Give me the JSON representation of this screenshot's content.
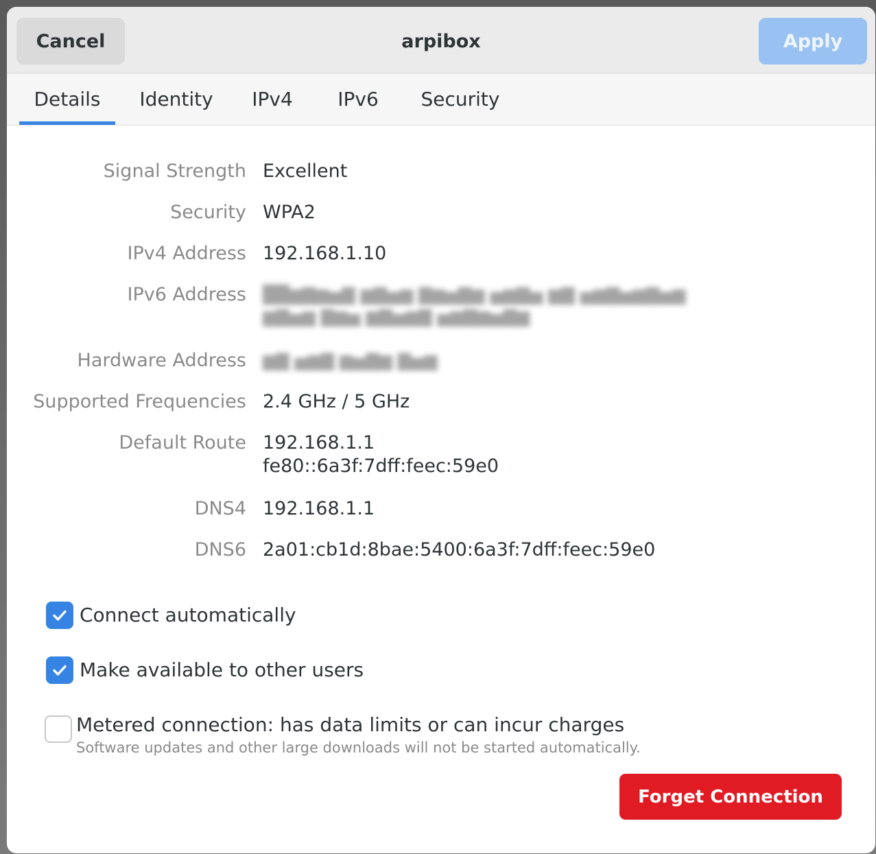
{
  "header": {
    "cancel_label": "Cancel",
    "title": "arpibox",
    "apply_label": "Apply"
  },
  "tabs": [
    {
      "label": "Details",
      "active": true
    },
    {
      "label": "Identity",
      "active": false
    },
    {
      "label": "IPv4",
      "active": false
    },
    {
      "label": "IPv6",
      "active": false
    },
    {
      "label": "Security",
      "active": false
    }
  ],
  "details": {
    "signal_strength": {
      "label": "Signal Strength",
      "value": "Excellent"
    },
    "security": {
      "label": "Security",
      "value": "WPA2"
    },
    "ipv4_address": {
      "label": "IPv4 Address",
      "value": "192.168.1.10"
    },
    "ipv6_address": {
      "label": "IPv6 Address",
      "value_redacted": true
    },
    "hardware_address": {
      "label": "Hardware Address",
      "value_redacted": true
    },
    "supported_frequencies": {
      "label": "Supported Frequencies",
      "value": "2.4 GHz / 5 GHz"
    },
    "default_route": {
      "label": "Default Route",
      "value_line1": "192.168.1.1",
      "value_line2": "fe80::6a3f:7dff:feec:59e0"
    },
    "dns4": {
      "label": "DNS4",
      "value": "192.168.1.1"
    },
    "dns6": {
      "label": "DNS6",
      "value": "2a01:cb1d:8bae:5400:6a3f:7dff:feec:59e0"
    }
  },
  "options": {
    "connect_automatically": {
      "label": "Connect automatically",
      "checked": true
    },
    "available_to_others": {
      "label": "Make available to other users",
      "checked": true
    },
    "metered": {
      "label": "Metered connection: has data limits or can incur charges",
      "sublabel": "Software updates and other large downloads will not be started automatically.",
      "checked": false
    }
  },
  "forget_label": "Forget Connection",
  "colors": {
    "accent": "#3584e4",
    "apply_disabled": "#99c1f1",
    "destructive": "#e01b24"
  },
  "icons": {
    "checkmark": "checkmark-icon"
  }
}
